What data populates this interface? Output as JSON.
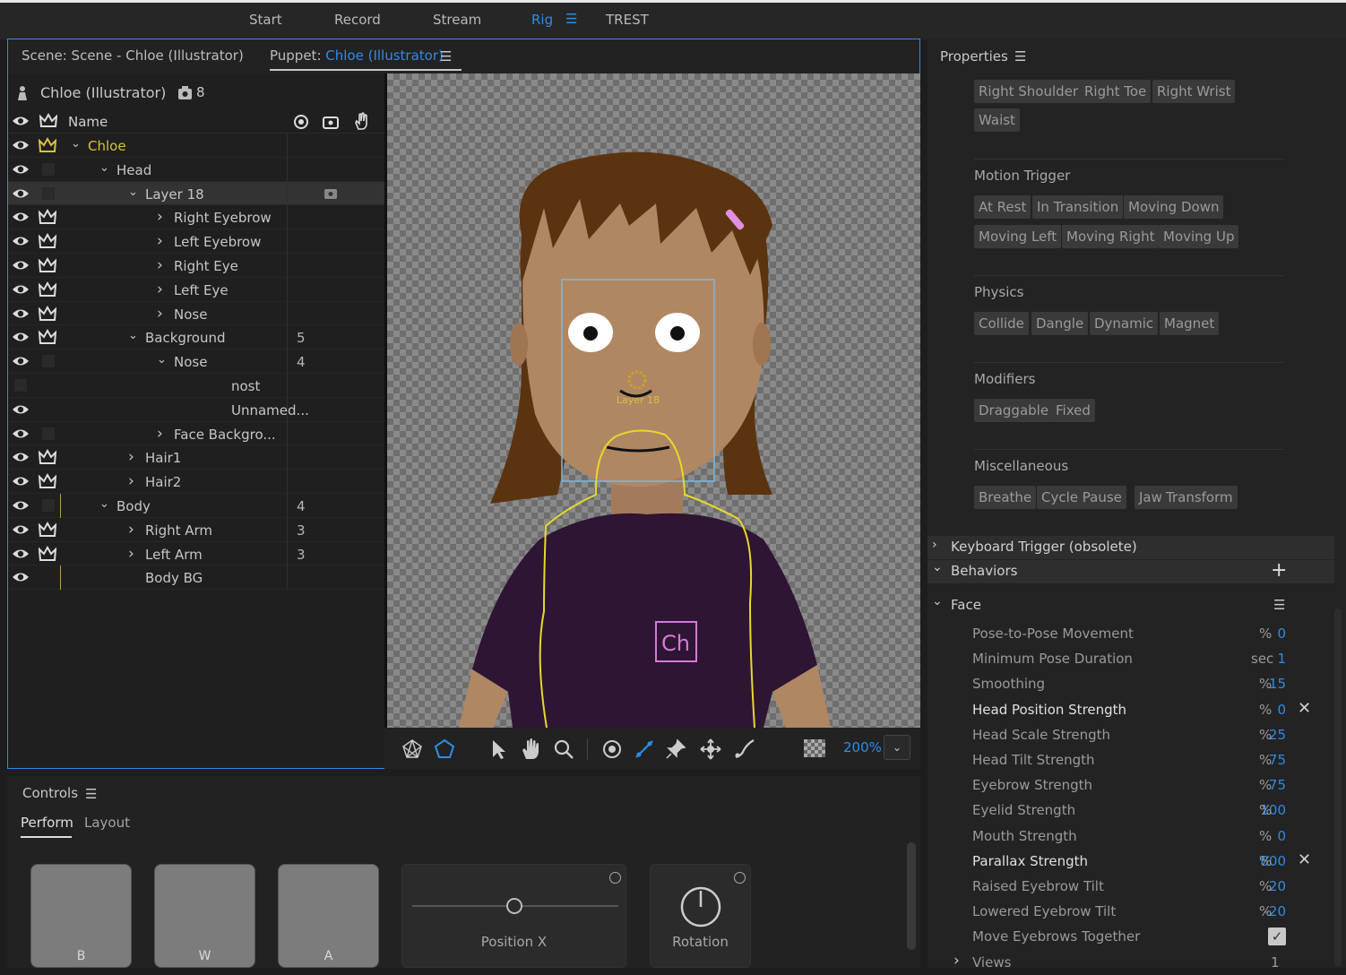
{
  "topnav": {
    "start": "Start",
    "record": "Record",
    "stream": "Stream",
    "rig": "Rig",
    "trest": "TREST"
  },
  "scene": {
    "scene_tab": "Scene: Scene - Chloe (Illustrator)",
    "puppet_prefix": "Puppet: ",
    "puppet_name": "Chloe (Illustrator)",
    "puppet_title": "Chloe (Illustrator)",
    "puppet_count": "8",
    "col_name": "Name",
    "zoom": "200%",
    "canvas_label": "Layer 18",
    "ch_logo": "Ch"
  },
  "layers": [
    {
      "label": "Chloe",
      "count": "",
      "color": "#d9c23a"
    },
    {
      "label": "Head",
      "count": ""
    },
    {
      "label": "Layer 18",
      "count": ""
    },
    {
      "label": "Right Eyebrow",
      "count": ""
    },
    {
      "label": "Left Eyebrow",
      "count": ""
    },
    {
      "label": "Right Eye",
      "count": ""
    },
    {
      "label": "Left Eye",
      "count": ""
    },
    {
      "label": "Nose",
      "count": ""
    },
    {
      "label": "Background",
      "count": "5"
    },
    {
      "label": "Nose",
      "count": "4"
    },
    {
      "label": "nost",
      "count": ""
    },
    {
      "label": "Unnamed...",
      "count": ""
    },
    {
      "label": "Face Backgro...",
      "count": ""
    },
    {
      "label": "Hair1",
      "count": ""
    },
    {
      "label": "Hair2",
      "count": ""
    },
    {
      "label": "Body",
      "count": "4"
    },
    {
      "label": "Right Arm",
      "count": "3"
    },
    {
      "label": "Left Arm",
      "count": "3"
    },
    {
      "label": "Body BG",
      "count": ""
    }
  ],
  "properties": {
    "title": "Properties",
    "handle_tags": [
      "Right Shoulder",
      "Right Toe",
      "Right Wrist",
      "Waist"
    ],
    "motion_title": "Motion Trigger",
    "motion_tags": [
      "At Rest",
      "In Transition",
      "Moving Down",
      "Moving Left",
      "Moving Right",
      "Moving Up"
    ],
    "physics_title": "Physics",
    "physics_tags": [
      "Collide",
      "Dangle",
      "Dynamic",
      "Magnet"
    ],
    "modifiers_title": "Modifiers",
    "modifiers_tags": [
      "Draggable",
      "Fixed"
    ],
    "misc_title": "Miscellaneous",
    "misc_tags": [
      "Breathe",
      "Cycle Pause",
      "Jaw",
      "Transform"
    ],
    "keyboard": "Keyboard Trigger (obsolete)",
    "behaviors": "Behaviors",
    "face": "Face",
    "params": [
      {
        "name": "Pose-to-Pose Movement",
        "value": "0",
        "unit": "%"
      },
      {
        "name": "Minimum Pose Duration",
        "value": "1",
        "unit": "sec"
      },
      {
        "name": "Smoothing",
        "value": "15",
        "unit": "%"
      },
      {
        "name": "Head Position Strength",
        "value": "0",
        "unit": "%"
      },
      {
        "name": "Head Scale Strength",
        "value": "25",
        "unit": "%"
      },
      {
        "name": "Head Tilt Strength",
        "value": "75",
        "unit": "%"
      },
      {
        "name": "Eyebrow Strength",
        "value": "75",
        "unit": "%"
      },
      {
        "name": "Eyelid Strength",
        "value": "100",
        "unit": "%"
      },
      {
        "name": "Mouth Strength",
        "value": "0",
        "unit": "%"
      },
      {
        "name": "Parallax Strength",
        "value": "800",
        "unit": "%"
      },
      {
        "name": "Raised Eyebrow Tilt",
        "value": "20",
        "unit": "%"
      },
      {
        "name": "Lowered Eyebrow Tilt",
        "value": "-20",
        "unit": "%"
      },
      {
        "name": "Move Eyebrows Together",
        "value": "",
        "unit": ""
      },
      {
        "name": "Views",
        "value": "1",
        "unit": ""
      }
    ]
  },
  "controls": {
    "title": "Controls",
    "tab_perform": "Perform",
    "tab_layout": "Layout",
    "buttons": [
      "B",
      "W",
      "A"
    ],
    "position_x": "Position X",
    "rotation": "Rotation"
  }
}
